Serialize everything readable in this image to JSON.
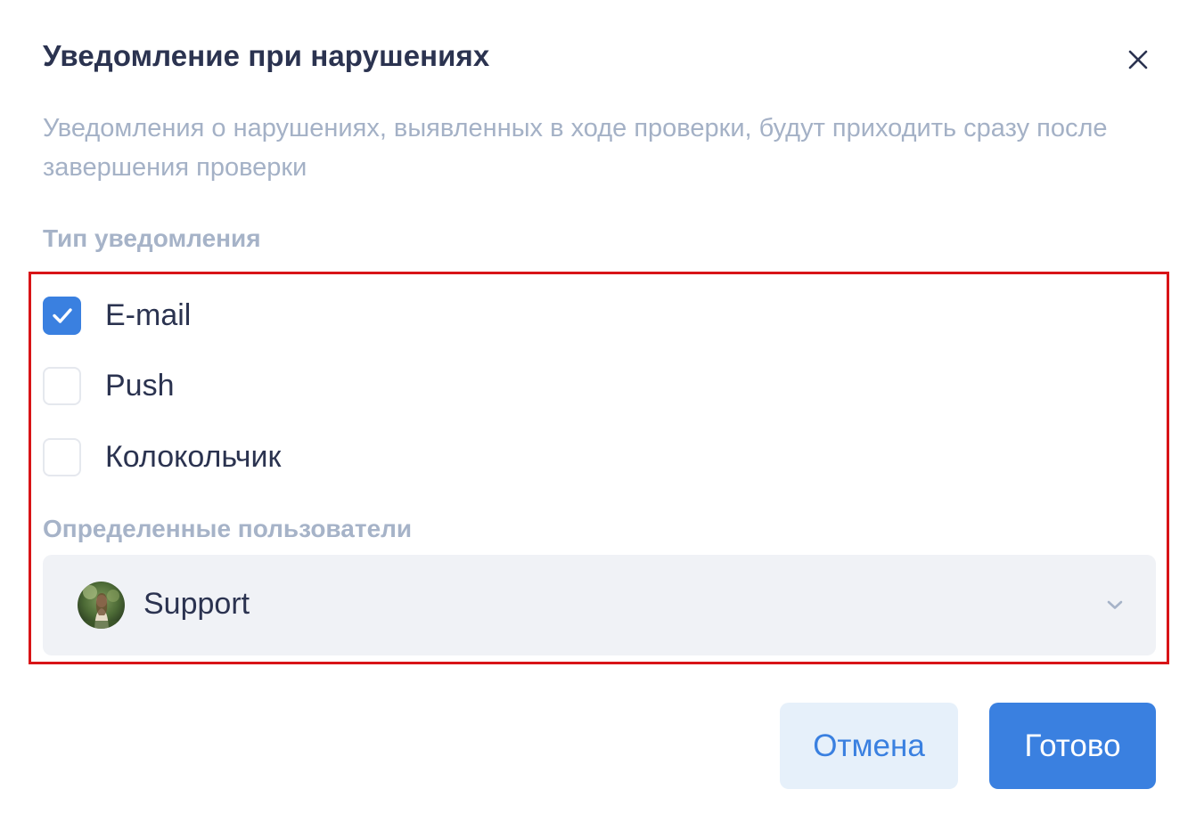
{
  "dialog": {
    "title": "Уведомление при нарушениях",
    "description": "Уведомления о нарушениях, выявленных в ходе проверки, будут приходить сразу после завершения проверки",
    "close_icon": "close-icon"
  },
  "notification_type": {
    "label": "Тип уведомления",
    "options": [
      {
        "label": "E-mail",
        "checked": true
      },
      {
        "label": "Push",
        "checked": false
      },
      {
        "label": "Колокольчик",
        "checked": false
      }
    ]
  },
  "users": {
    "label": "Определенные пользователи",
    "selected": "Support",
    "chevron_icon": "chevron-down-icon"
  },
  "buttons": {
    "cancel": "Отмена",
    "done": "Готово"
  },
  "colors": {
    "accent": "#3a80e0",
    "title_text": "#2b3350",
    "muted_text": "#a4b1c6",
    "highlight_border": "#d81417",
    "cancel_bg": "#e6f0fa",
    "select_bg": "#f0f2f6"
  }
}
